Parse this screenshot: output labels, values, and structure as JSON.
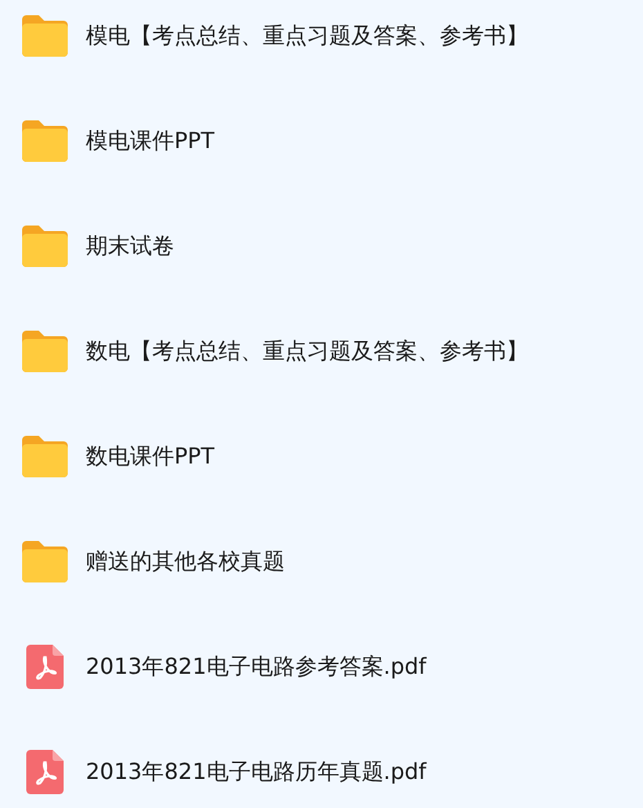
{
  "files": [
    {
      "kind": "folder",
      "name": "模电【考点总结、重点习题及答案、参考书】"
    },
    {
      "kind": "folder",
      "name": "模电课件PPT"
    },
    {
      "kind": "folder",
      "name": "期末试卷"
    },
    {
      "kind": "folder",
      "name": "数电【考点总结、重点习题及答案、参考书】"
    },
    {
      "kind": "folder",
      "name": "数电课件PPT"
    },
    {
      "kind": "folder",
      "name": "赠送的其他各校真题"
    },
    {
      "kind": "pdf",
      "name": "2013年821电子电路参考答案.pdf"
    },
    {
      "kind": "pdf",
      "name": "2013年821电子电路历年真题.pdf"
    }
  ]
}
